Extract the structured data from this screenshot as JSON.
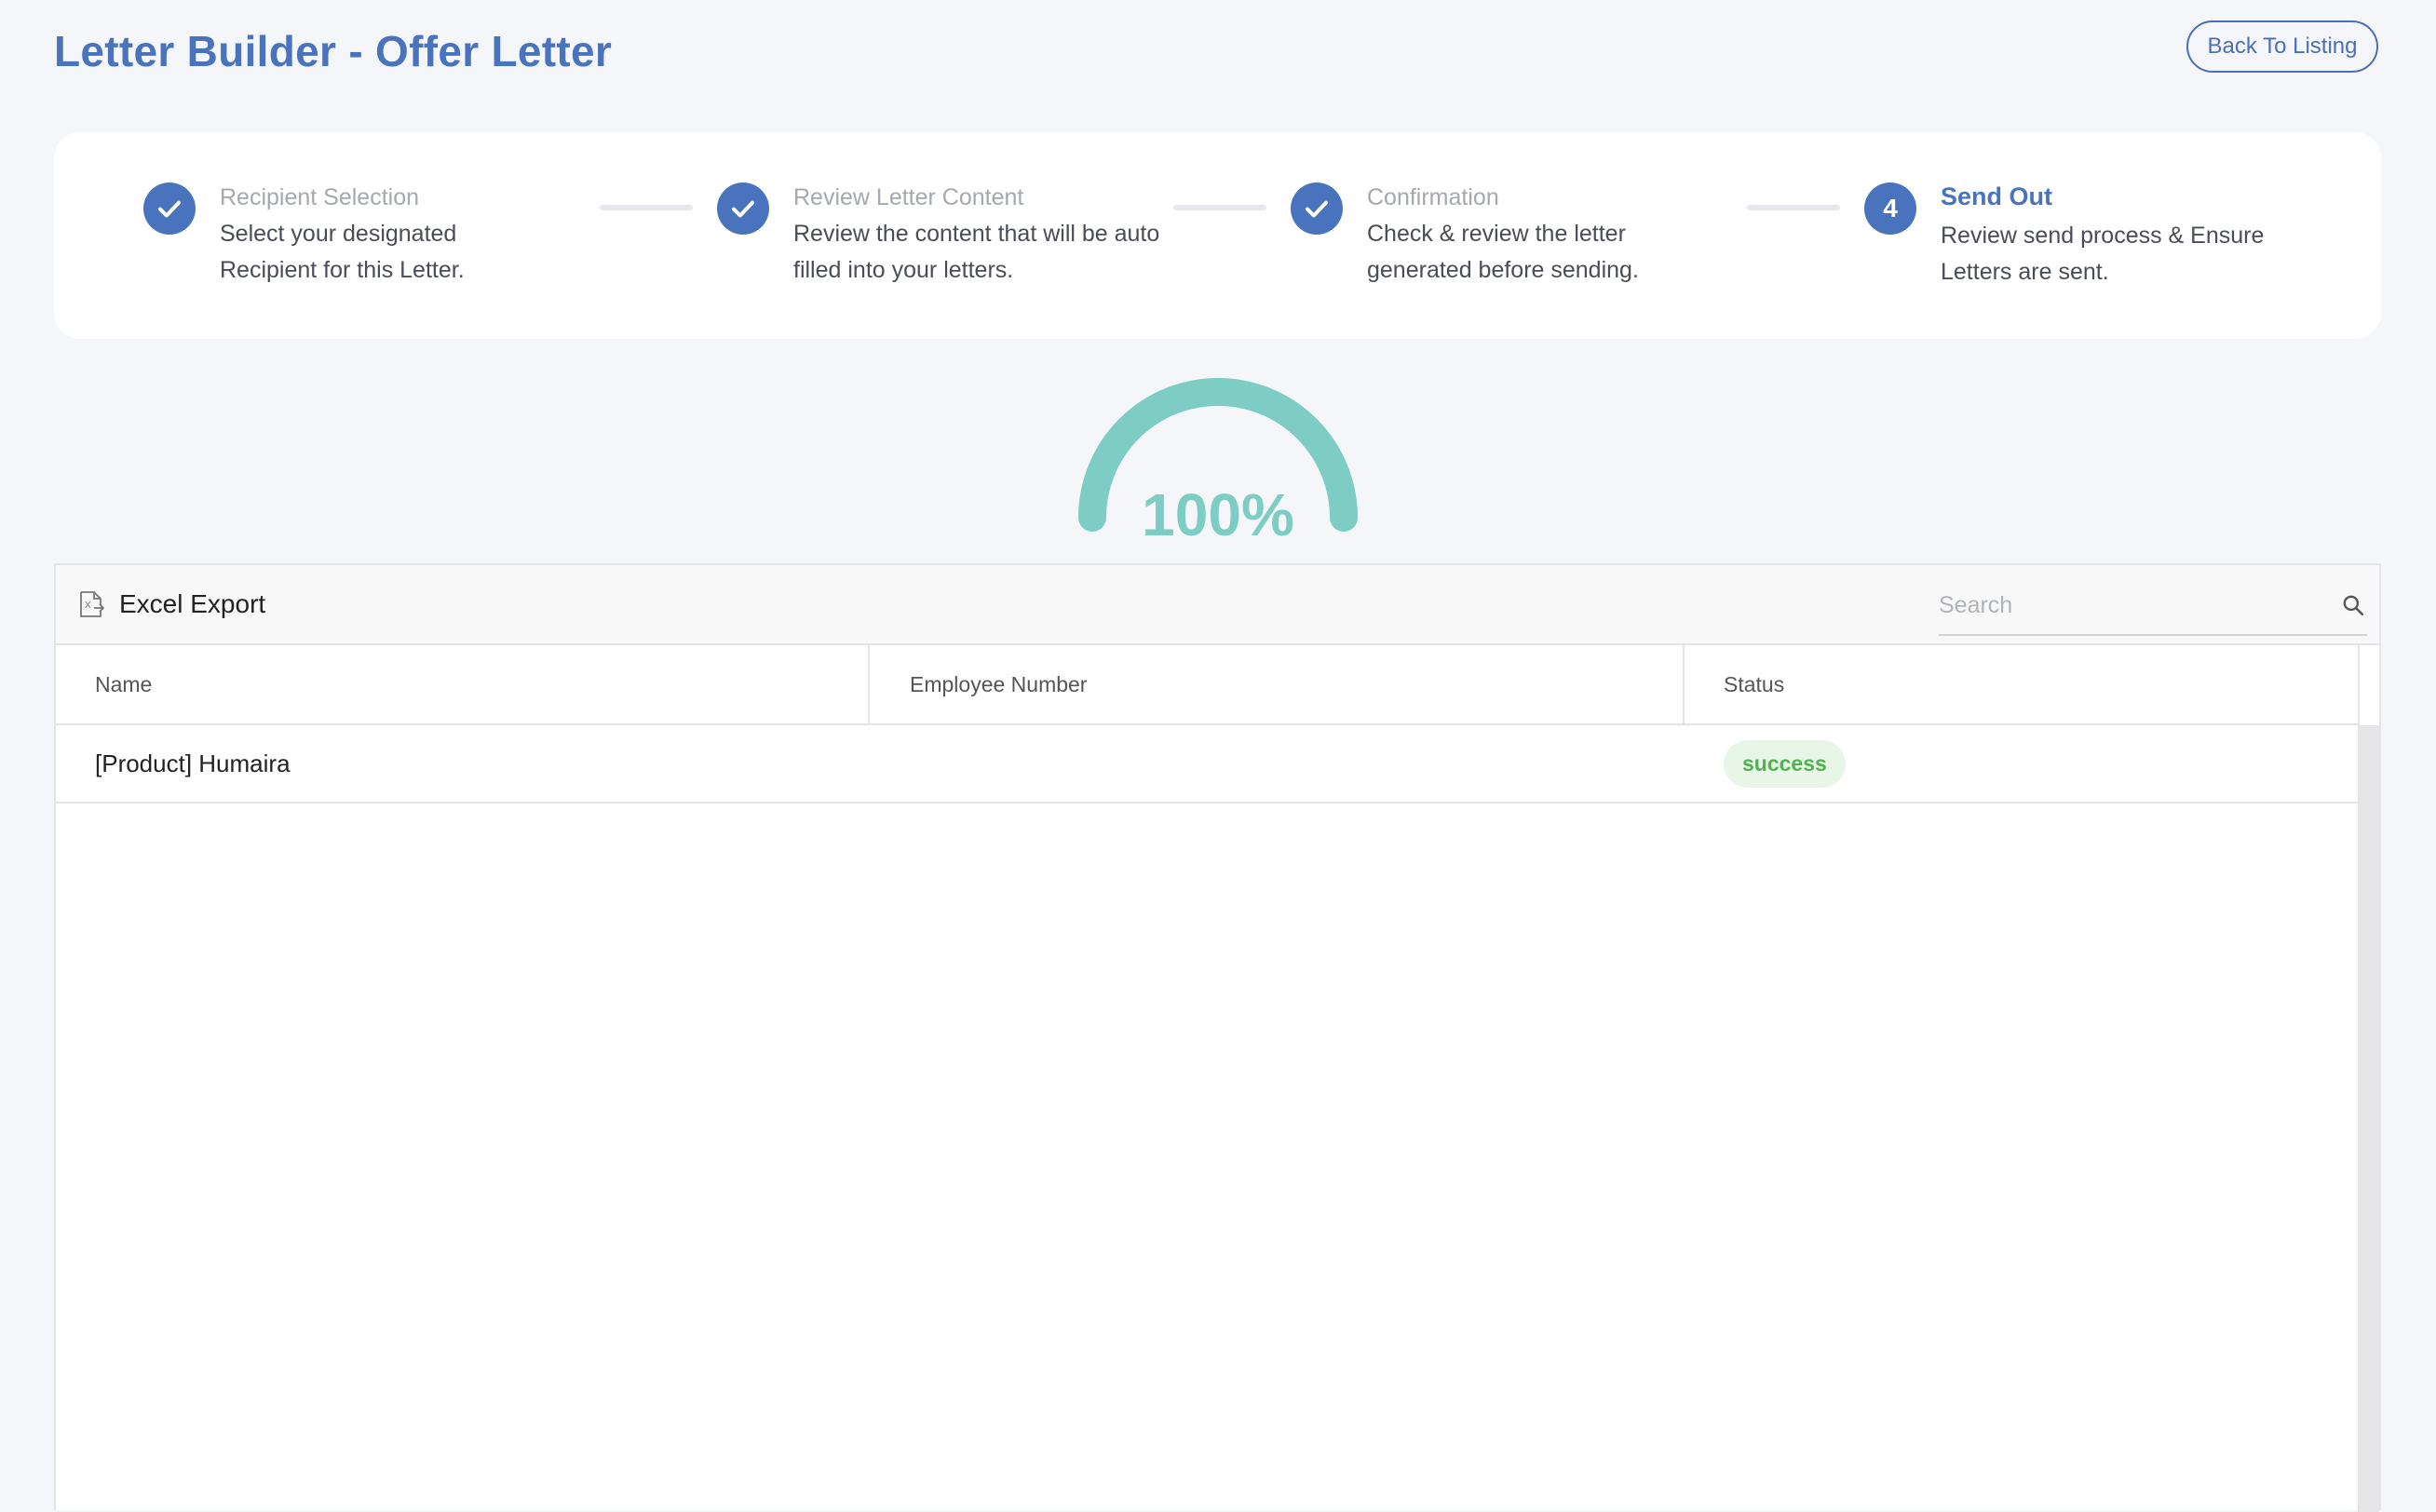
{
  "header": {
    "title": "Letter Builder - Offer Letter",
    "back_button": "Back To Listing"
  },
  "colors": {
    "primary": "#4a73bd",
    "gauge": "#7dcdc5",
    "success_text": "#4fb24f",
    "success_bg": "#e7f6e7"
  },
  "stepper": {
    "steps": [
      {
        "icon": "check-icon",
        "title": "Recipient Selection",
        "desc": "Select your designated Recipient for this Letter.",
        "state": "completed"
      },
      {
        "icon": "check-icon",
        "title": "Review Letter Content",
        "desc": "Review the content that will be auto filled into your letters.",
        "state": "completed"
      },
      {
        "icon": "check-icon",
        "title": "Confirmation",
        "desc": "Check & review the letter generated before sending.",
        "state": "completed"
      },
      {
        "number": "4",
        "title": "Send Out",
        "desc": "Review send process & Ensure Letters are sent.",
        "state": "active"
      }
    ]
  },
  "progress": {
    "percent_label": "100%",
    "value": 1.0
  },
  "table": {
    "toolbar": {
      "export_label": "Excel Export",
      "export_icon": "excel-file-icon",
      "search_placeholder": "Search",
      "search_icon": "search-icon"
    },
    "columns": [
      "Name",
      "Employee Number",
      "Status"
    ],
    "rows": [
      {
        "name": "[Product] Humaira",
        "employee_number": "",
        "status": "success"
      }
    ]
  }
}
